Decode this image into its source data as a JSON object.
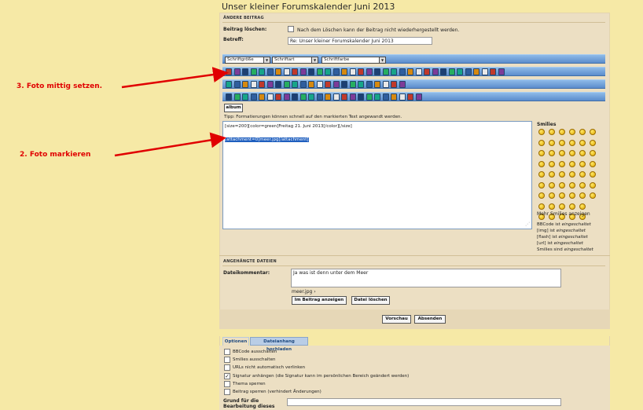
{
  "page": {
    "title": "Unser kleiner Forumskalender Juni 2013"
  },
  "edit_section": {
    "heading": "ÄNDERE BEITRAG",
    "delete_label": "Beitrag löschen:",
    "delete_note": "Nach dem Löschen kann der Beitrag nicht wiederhergestellt werden.",
    "subject_label": "Betreff:",
    "subject_value": "Re: Unser kleiner Forumskalender Juni 2013"
  },
  "toolbar": {
    "font_size": "Schriftgröße",
    "font_family": "Schriftart",
    "font_color": "Schriftfarbe",
    "album": "album",
    "tip": "Tipp: Formatierungen können schnell auf den markierten Text angewandt werden."
  },
  "editor": {
    "line1": "[size=200][color=green]Freitag 21. Juni 2013[/color][/size]",
    "line2": "[attachment=0]meer.jpg[/attachment]"
  },
  "annotations": {
    "arrow1": "3. Foto mittig setzen.",
    "arrow2": "2. Foto markieren",
    "color": "#e00000"
  },
  "smilies": {
    "title": "Smilies",
    "more": "Mehr Smilies anzeigen",
    "status": [
      {
        "prefix": "BBCode ist ",
        "state": "eingeschaltet"
      },
      {
        "prefix": "[img] ist ",
        "state": "eingeschaltet"
      },
      {
        "prefix": "[flash] ist ",
        "state": "eingeschaltet"
      },
      {
        "prefix": "[url] ist ",
        "state": "eingeschaltet"
      },
      {
        "prefix": "Smilies sind ",
        "state": "eingeschaltet"
      }
    ]
  },
  "attachments": {
    "heading": "ANGEHÄNGTE DATEIEN",
    "comment_label": "Dateikommentar:",
    "comment_value": "Ja was ist denn unter dem Meer",
    "file_name": "meer.jpg ›",
    "show_in_post": "Im Beitrag anzeigen",
    "delete_file": "Datei löschen"
  },
  "actions": {
    "preview": "Vorschau",
    "submit": "Absenden"
  },
  "options": {
    "tabs": [
      "Optionen",
      "Dateianhang hochladen"
    ],
    "items": [
      {
        "label": "BBCode ausschalten",
        "checked": false
      },
      {
        "label": "Smilies ausschalten",
        "checked": false
      },
      {
        "label": "URLs nicht automatisch verlinken",
        "checked": false
      },
      {
        "label": "Signatur anhängen (die Signatur kann im persönlichen Bereich geändert werden)",
        "checked": true
      },
      {
        "label": "Thema sperren",
        "checked": false
      },
      {
        "label": "Beitrag sperren (verhindert Änderungen)",
        "checked": false
      }
    ],
    "reason_label": "Grund für die Bearbeitung dieses"
  },
  "colors": {
    "toolbar_blue": "#5b8ccc",
    "panel": "#ecdfc3",
    "background": "#f6e9a6",
    "selection": "#1f5fbf"
  }
}
